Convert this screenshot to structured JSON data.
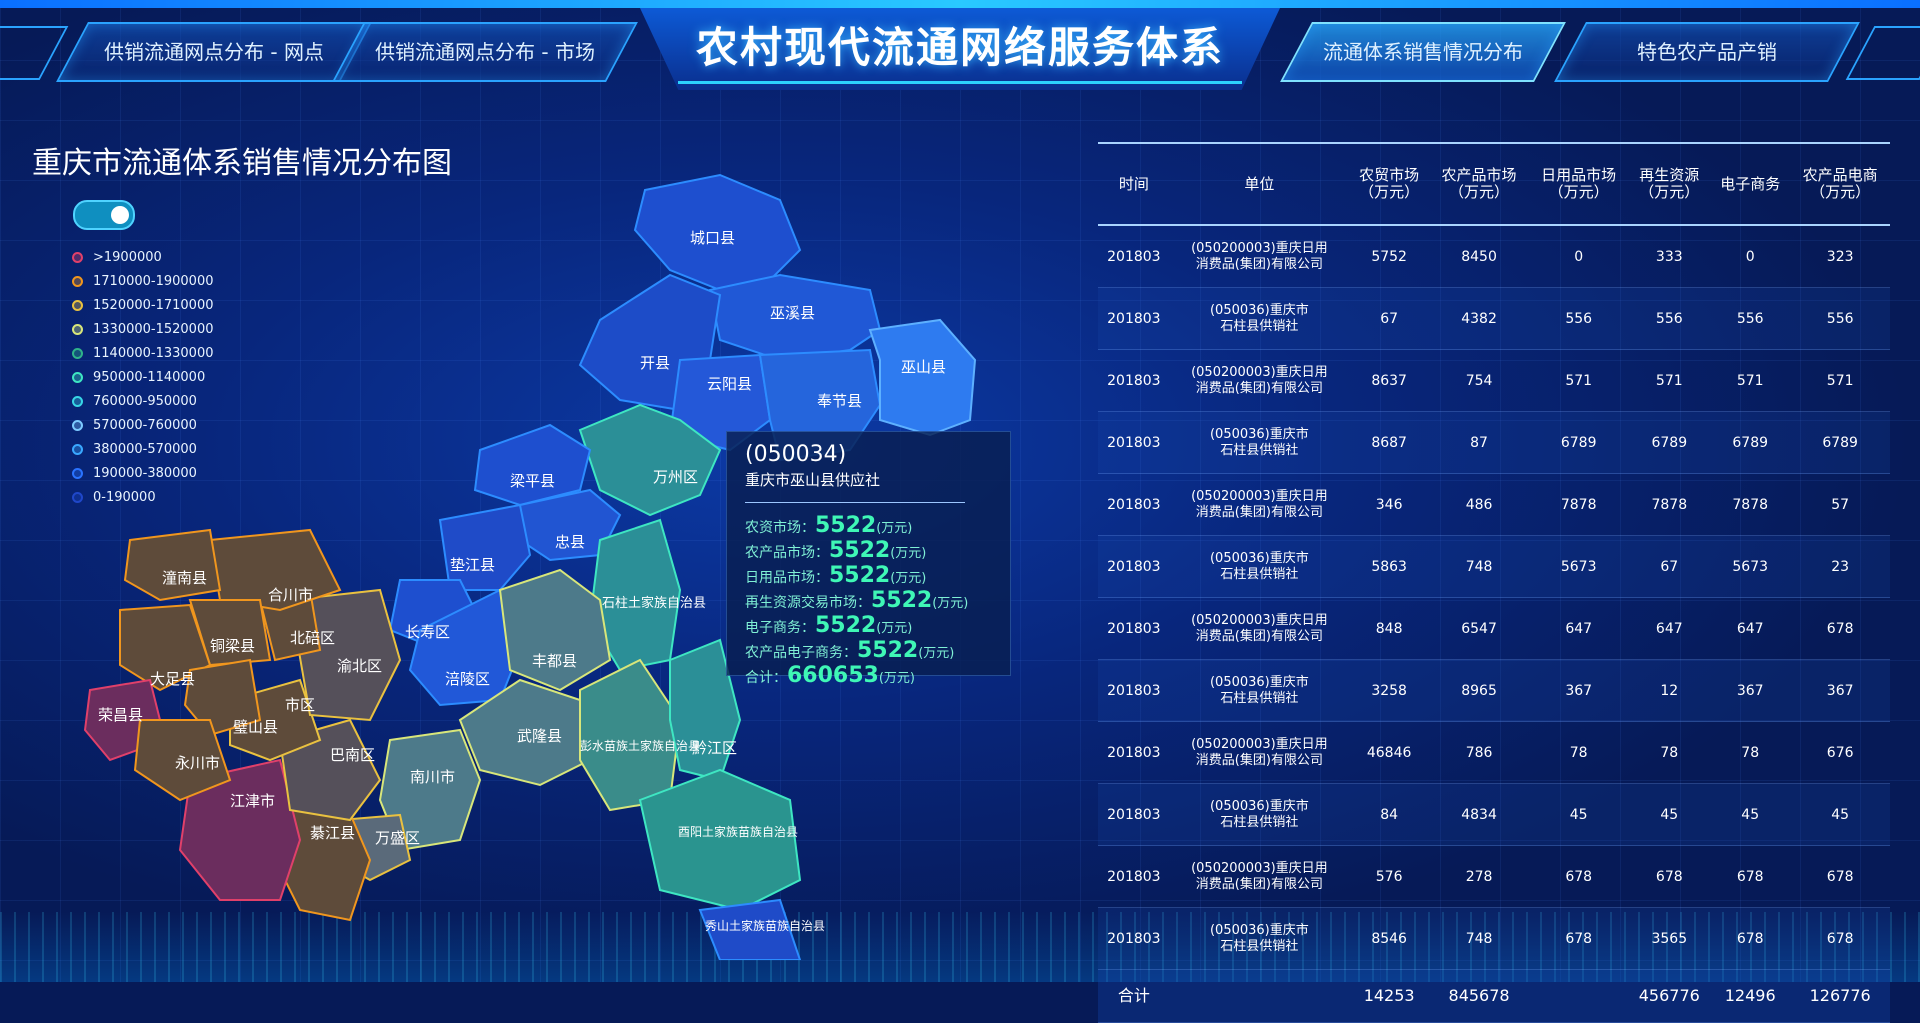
{
  "header": {
    "title": "农村现代流通网络服务体系",
    "tabs": [
      {
        "label": "供销流通网点分布 - 网点"
      },
      {
        "label": "供销流通网点分布 - 市场"
      },
      {
        "label": "流通体系销售情况分布"
      },
      {
        "label": "特色农产品产销"
      }
    ],
    "active_tab_index": 2
  },
  "map": {
    "title": "重庆市流通体系销售情况分布图",
    "toggle_on": true,
    "legend": [
      {
        "label": ">1900000",
        "color": "#e0406a"
      },
      {
        "label": "1710000-1900000",
        "color": "#f0961e"
      },
      {
        "label": "1520000-1710000",
        "color": "#e9c140"
      },
      {
        "label": "1330000-1520000",
        "color": "#d8e67a"
      },
      {
        "label": "1140000-1330000",
        "color": "#2fb38a"
      },
      {
        "label": "950000-1140000",
        "color": "#3ee6c2"
      },
      {
        "label": "760000-950000",
        "color": "#38d6e6"
      },
      {
        "label": "570000-760000",
        "color": "#7cc9ff"
      },
      {
        "label": "380000-570000",
        "color": "#3aa8ff"
      },
      {
        "label": "190000-380000",
        "color": "#2a73ff"
      },
      {
        "label": "0-190000",
        "color": "#1f47c9"
      }
    ],
    "regions": {
      "chengkou": "城口县",
      "wuxi": "巫溪县",
      "kaixian": "开县",
      "yunyang": "云阳县",
      "fengjie": "奉节县",
      "wushan": "巫山县",
      "wanzhou": "万州区",
      "liangping": "梁平县",
      "zhongxian": "忠县",
      "dianjiang": "垫江县",
      "shizhu": "石柱土家族自治县",
      "changshou": "长寿区",
      "fuling": "涪陵区",
      "fengdu": "丰都县",
      "wulong": "武隆县",
      "pengshui": "彭水苗族土家族自治县",
      "qianjiang": "黔江区",
      "youyang": "酉阳土家族苗族自治县",
      "xiushan": "秀山土家族苗族自治县",
      "nanchuan": "南川市",
      "wansheng": "万盛区",
      "qijiang": "綦江县",
      "jiangjin": "江津市",
      "banan": "巴南区",
      "shiqu": "市区",
      "yubei": "渝北区",
      "beibei": "北碚区",
      "hechuan": "合川市",
      "tongnan": "潼南县",
      "tongliang": "铜梁县",
      "dazu": "大足县",
      "rongchang": "荣昌县",
      "bishan": "璧山县",
      "yongchuan": "永川市"
    }
  },
  "tooltip": {
    "code": "(050034)",
    "name": "重庆市巫山县供应社",
    "unit": "(万元)",
    "rows": [
      {
        "label": "农资市场：",
        "value": "5522"
      },
      {
        "label": "农产品市场：",
        "value": "5522"
      },
      {
        "label": "日用品市场：",
        "value": "5522"
      },
      {
        "label": "再生资源交易市场：",
        "value": "5522"
      },
      {
        "label": "电子商务：",
        "value": "5522"
      },
      {
        "label": "农产品电子商务：",
        "value": "5522"
      }
    ],
    "total_label": "合计：",
    "total_value": "660653"
  },
  "table": {
    "headers": [
      {
        "l1": "时间",
        "l2": ""
      },
      {
        "l1": "单位",
        "l2": ""
      },
      {
        "l1": "农贸市场",
        "l2": "（万元）"
      },
      {
        "l1": "农产品市场",
        "l2": "（万元）"
      },
      {
        "l1": "日用品市场",
        "l2": "（万元）"
      },
      {
        "l1": "再生资源",
        "l2": "（万元）"
      },
      {
        "l1": "电子商务",
        "l2": ""
      },
      {
        "l1": "农产品电商",
        "l2": "（万元）"
      }
    ],
    "rows": [
      {
        "time": "201803",
        "unit1": "(050200003)重庆日用",
        "unit2": "消费品(集团)有限公司",
        "c1": "5752",
        "c2": "8450",
        "c3": "0",
        "c4": "333",
        "c5": "0",
        "c6": "323"
      },
      {
        "time": "201803",
        "unit1": "(050036)重庆市",
        "unit2": "石柱县供销社",
        "c1": "67",
        "c2": "4382",
        "c3": "556",
        "c4": "556",
        "c5": "556",
        "c6": "556"
      },
      {
        "time": "201803",
        "unit1": "(050200003)重庆日用",
        "unit2": "消费品(集团)有限公司",
        "c1": "8637",
        "c2": "754",
        "c3": "571",
        "c4": "571",
        "c5": "571",
        "c6": "571"
      },
      {
        "time": "201803",
        "unit1": "(050036)重庆市",
        "unit2": "石柱县供销社",
        "c1": "8687",
        "c2": "87",
        "c3": "6789",
        "c4": "6789",
        "c5": "6789",
        "c6": "6789"
      },
      {
        "time": "201803",
        "unit1": "(050200003)重庆日用",
        "unit2": "消费品(集团)有限公司",
        "c1": "346",
        "c2": "486",
        "c3": "7878",
        "c4": "7878",
        "c5": "7878",
        "c6": "57"
      },
      {
        "time": "201803",
        "unit1": "(050036)重庆市",
        "unit2": "石柱县供销社",
        "c1": "5863",
        "c2": "748",
        "c3": "5673",
        "c4": "67",
        "c5": "5673",
        "c6": "23"
      },
      {
        "time": "201803",
        "unit1": "(050200003)重庆日用",
        "unit2": "消费品(集团)有限公司",
        "c1": "848",
        "c2": "6547",
        "c3": "647",
        "c4": "647",
        "c5": "647",
        "c6": "678"
      },
      {
        "time": "201803",
        "unit1": "(050036)重庆市",
        "unit2": "石柱县供销社",
        "c1": "3258",
        "c2": "8965",
        "c3": "367",
        "c4": "12",
        "c5": "367",
        "c6": "367"
      },
      {
        "time": "201803",
        "unit1": "(050200003)重庆日用",
        "unit2": "消费品(集团)有限公司",
        "c1": "46846",
        "c2": "786",
        "c3": "78",
        "c4": "78",
        "c5": "78",
        "c6": "676"
      },
      {
        "time": "201803",
        "unit1": "(050036)重庆市",
        "unit2": "石柱县供销社",
        "c1": "84",
        "c2": "4834",
        "c3": "45",
        "c4": "45",
        "c5": "45",
        "c6": "45"
      },
      {
        "time": "201803",
        "unit1": "(050200003)重庆日用",
        "unit2": "消费品(集团)有限公司",
        "c1": "576",
        "c2": "278",
        "c3": "678",
        "c4": "678",
        "c5": "678",
        "c6": "678"
      },
      {
        "time": "201803",
        "unit1": "(050036)重庆市",
        "unit2": "石柱县供销社",
        "c1": "8546",
        "c2": "748",
        "c3": "678",
        "c4": "3565",
        "c5": "678",
        "c6": "678"
      }
    ],
    "total": {
      "label": "合计",
      "c1": "14253",
      "c2": "845678",
      "c3": "",
      "c4": "456776",
      "c5": "12496",
      "c6": "126776"
    }
  }
}
